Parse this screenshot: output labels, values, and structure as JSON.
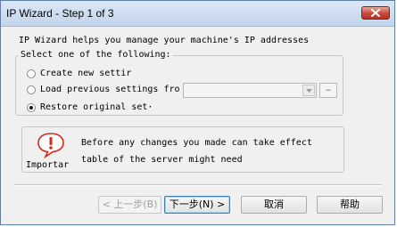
{
  "window": {
    "title": "IP Wizard - Step 1 of 3"
  },
  "intro_text": "IP Wizard helps you manage your machine's IP addresses",
  "options_group": {
    "legend": "Select one of the following:",
    "options": [
      {
        "label": "Create new settir",
        "selected": false
      },
      {
        "label": "Load previous settings fro",
        "selected": false
      },
      {
        "label": "Restore original set·",
        "selected": true
      }
    ],
    "settings_combo_value": "",
    "browse_label": "…"
  },
  "notice": {
    "icon": "warning-icon",
    "icon_label": "Importar",
    "lines": [
      "Before any changes you made can take effect",
      "table of the server might need"
    ]
  },
  "buttons": {
    "back": "< 上一步(B)",
    "next": "下一步(N) >",
    "cancel": "取消",
    "help": "帮助"
  },
  "colors": {
    "title_gradient_top": "#dbe7f5",
    "close_button": "#c8473a",
    "warning_red": "#d42a1c",
    "dialog_bg": "#f0f0f0"
  }
}
